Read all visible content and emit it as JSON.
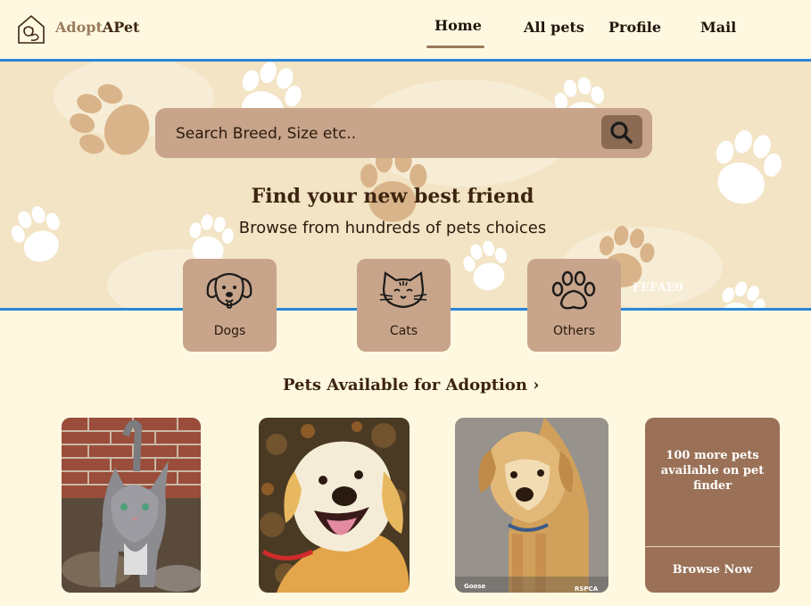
{
  "header": {
    "brand_part1": "Adopt",
    "brand_part2": "APet",
    "logo_icon": "house-pet-icon",
    "nav": [
      {
        "label": "Home",
        "active": true
      },
      {
        "label": "All pets"
      },
      {
        "label": "Profile"
      },
      {
        "label": "Mail"
      }
    ]
  },
  "hero": {
    "search_placeholder": "Search Breed, Size etc..",
    "search_icon": "search-icon",
    "title": "Find your new best friend",
    "subtitle": "Browse from hundreds of pets choices",
    "background_color_label": "FEFAE0",
    "categories": [
      {
        "label": "Dogs",
        "icon": "dog-icon"
      },
      {
        "label": "Cats",
        "icon": "cat-icon"
      },
      {
        "label": "Others",
        "icon": "paw-icon"
      }
    ]
  },
  "adoption": {
    "section_title": "Pets Available for Adoption ›",
    "pets": [
      {
        "kind": "cat",
        "photo": "gray-tabby-cat-photo"
      },
      {
        "kind": "dog",
        "photo": "happy-golden-dog-photo"
      },
      {
        "kind": "dog",
        "photo": "labrador-dog-photo",
        "caption": "Goose",
        "watermark": "RSPCA"
      }
    ],
    "more_card": {
      "text": "100 more pets available on pet finder",
      "button": "Browse Now"
    }
  },
  "colors": {
    "page_bg": "#FFF8E1",
    "hero_bg": "#F2E4C4",
    "accent": "#C7A48A",
    "dark_brown": "#3d2410",
    "card_brown": "#9a7157",
    "guide_blue": "#2a86d8"
  }
}
